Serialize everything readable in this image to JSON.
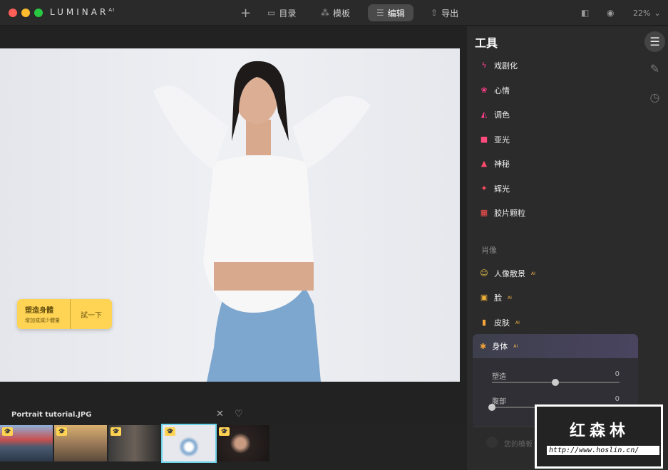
{
  "app": {
    "name": "LUMINAR",
    "name_sup": "AI"
  },
  "nav": {
    "add": "+",
    "catalog": "目录",
    "templates": "模板",
    "edit": "编辑",
    "export": "导出"
  },
  "toolbar": {
    "zoom": "22%"
  },
  "hint": {
    "title": "塑造身體",
    "subtitle": "增加或減少體量",
    "action": "試一下"
  },
  "filmstrip": {
    "filename": "Portrait tutorial.JPG",
    "thumbs": [
      {
        "badge": "🎓"
      },
      {
        "badge": "🎓"
      },
      {
        "badge": "🎓"
      },
      {
        "badge": "🎓",
        "selected": true
      },
      {
        "badge": "🎓"
      }
    ]
  },
  "panel": {
    "title": "工具",
    "tools": [
      {
        "label": "戏剧化",
        "icon": "lightning-icon",
        "glyph": "ϟ",
        "color": "#ff3e8a"
      },
      {
        "label": "心情",
        "icon": "lotus-icon",
        "glyph": "❀",
        "color": "#ff3e8a"
      },
      {
        "label": "调色",
        "icon": "paint-bucket-icon",
        "glyph": "◭",
        "color": "#ff3e8a"
      },
      {
        "label": "亚光",
        "icon": "square-icon",
        "glyph": "■",
        "color": "#ff4a7e"
      },
      {
        "label": "神秘",
        "icon": "mystic-icon",
        "glyph": "▲",
        "color": "#ff4a6e"
      },
      {
        "label": "辉光",
        "icon": "sparkle-icon",
        "glyph": "✦",
        "color": "#ff4a60"
      },
      {
        "label": "胶片颗粒",
        "icon": "film-icon",
        "glyph": "▦",
        "color": "#ff5050"
      }
    ],
    "section": "肖像",
    "portrait": [
      {
        "label": "人像散景",
        "ai": "AI",
        "icon": "portrait-bokeh-icon",
        "glyph": "☺",
        "color": "#f2c84b"
      },
      {
        "label": "脸",
        "ai": "AI",
        "icon": "face-icon",
        "glyph": "▣",
        "color": "#f2b33a"
      },
      {
        "label": "皮肤",
        "ai": "AI",
        "icon": "skin-bottle-icon",
        "glyph": "▮",
        "color": "#f5a53a"
      }
    ],
    "body": {
      "label": "身体",
      "ai": "AI",
      "sliders": [
        {
          "label": "塑造",
          "value": "0",
          "pos": 0.5
        },
        {
          "label": "腹部",
          "value": "0",
          "pos": 0
        }
      ]
    },
    "templates_label": "您的模板"
  },
  "watermark": {
    "text": "红森林",
    "url": "http://www.hoslin.cn/"
  }
}
